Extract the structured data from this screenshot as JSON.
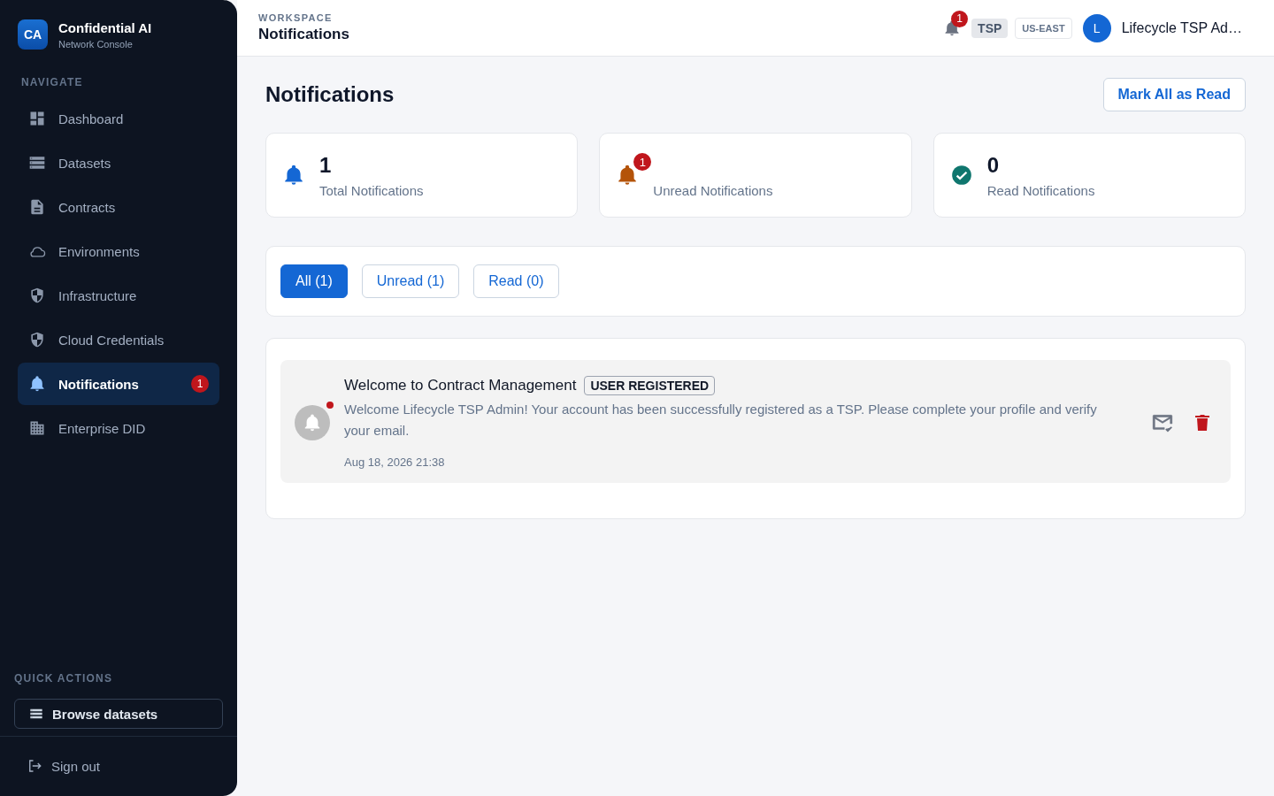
{
  "sidebar": {
    "logo": "CA",
    "app_name": "Confidential AI",
    "app_subtitle": "Network Console",
    "nav_heading": "NAVIGATE",
    "items": [
      {
        "label": "Dashboard",
        "selected": false
      },
      {
        "label": "Datasets",
        "selected": false
      },
      {
        "label": "Contracts",
        "selected": false
      },
      {
        "label": "Environments",
        "selected": false
      },
      {
        "label": "Infrastructure",
        "selected": false
      },
      {
        "label": "Cloud Credentials",
        "selected": false
      },
      {
        "label": "Notifications",
        "selected": true,
        "badge": "1"
      },
      {
        "label": "Enterprise DID",
        "selected": false
      }
    ],
    "quick_heading": "QUICK ACTIONS",
    "quick_action": "Browse datasets",
    "sign_out": "Sign out"
  },
  "header": {
    "eyebrow": "WORKSPACE",
    "title": "Notifications",
    "bell_badge": "1",
    "role": "TSP",
    "region": "US-EAST",
    "avatar": "L",
    "user": "Lifecycle TSP Ad…"
  },
  "page": {
    "title": "Notifications",
    "mark_all": "Mark All as Read"
  },
  "stats": [
    {
      "value": "1",
      "label": "Total Notifications"
    },
    {
      "badge": "1",
      "label": "Unread Notifications"
    },
    {
      "value": "0",
      "label": "Read Notifications"
    }
  ],
  "filters": [
    {
      "label": "All (1)",
      "selected": true
    },
    {
      "label": "Unread (1)",
      "selected": false
    },
    {
      "label": "Read (0)",
      "selected": false
    }
  ],
  "notifications": [
    {
      "title": "Welcome to Contract Management",
      "tag": "USER REGISTERED",
      "message": "Welcome Lifecycle TSP Admin! Your account has been successfully registered as a TSP. Please complete your profile and verify your email.",
      "time": "Aug 18, 2026 21:38",
      "unread": true
    }
  ]
}
